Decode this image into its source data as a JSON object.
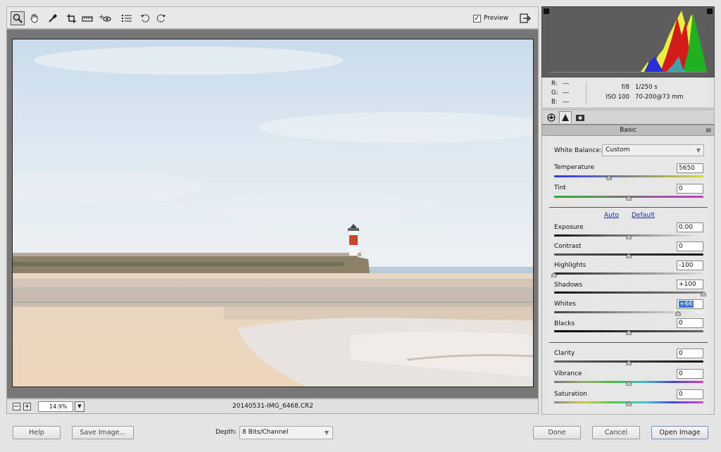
{
  "toolbar": {
    "tools": [
      "zoom-tool-icon",
      "hand-tool-icon",
      "white-balance-tool-icon",
      "crop-tool-icon",
      "straighten-tool-icon",
      "red-eye-removal-icon",
      "preferences-icon",
      "rotate-left-icon",
      "rotate-right-icon"
    ],
    "preview_label": "Preview",
    "preview_checked": true
  },
  "status": {
    "zoom": "14.9%",
    "filename": "20140531-IMG_6468.CR2"
  },
  "info": {
    "r_label": "R:",
    "r_value": "---",
    "g_label": "G:",
    "g_value": "---",
    "b_label": "B:",
    "b_value": "---",
    "aperture": "f/8",
    "shutter": "1/250 s",
    "iso": "ISO 100",
    "lens": "70-200@73 mm"
  },
  "panel": {
    "title": "Basic",
    "tabs": [
      "basic-tab-icon",
      "tone-curve-tab-icon",
      "camera-calibration-tab-icon"
    ],
    "white_balance_label": "White Balance:",
    "white_balance_value": "Custom",
    "temperature": {
      "label": "Temperature",
      "value": "5650",
      "level": 0.37
    },
    "tint": {
      "label": "Tint",
      "value": "0",
      "level": 0.5
    },
    "auto_label": "Auto",
    "default_label": "Default",
    "exposure": {
      "label": "Exposure",
      "value": "0.00",
      "level": 0.5
    },
    "contrast": {
      "label": "Contrast",
      "value": "0",
      "level": 0.5
    },
    "highlights": {
      "label": "Highlights",
      "value": "-100",
      "level": 0.0
    },
    "shadows": {
      "label": "Shadows",
      "value": "+100",
      "level": 1.0
    },
    "whites": {
      "label": "Whites",
      "value": "+66",
      "level": 0.83
    },
    "blacks": {
      "label": "Blacks",
      "value": "0",
      "level": 0.5
    },
    "clarity": {
      "label": "Clarity",
      "value": "0",
      "level": 0.5
    },
    "vibrance": {
      "label": "Vibrance",
      "value": "0",
      "level": 0.5
    },
    "saturation": {
      "label": "Saturation",
      "value": "0",
      "level": 0.5
    }
  },
  "footer": {
    "help": "Help",
    "save_image": "Save Image...",
    "depth_label": "Depth:",
    "depth_value": "8 Bits/Channel",
    "done": "Done",
    "cancel": "Cancel",
    "open_image": "Open Image"
  }
}
